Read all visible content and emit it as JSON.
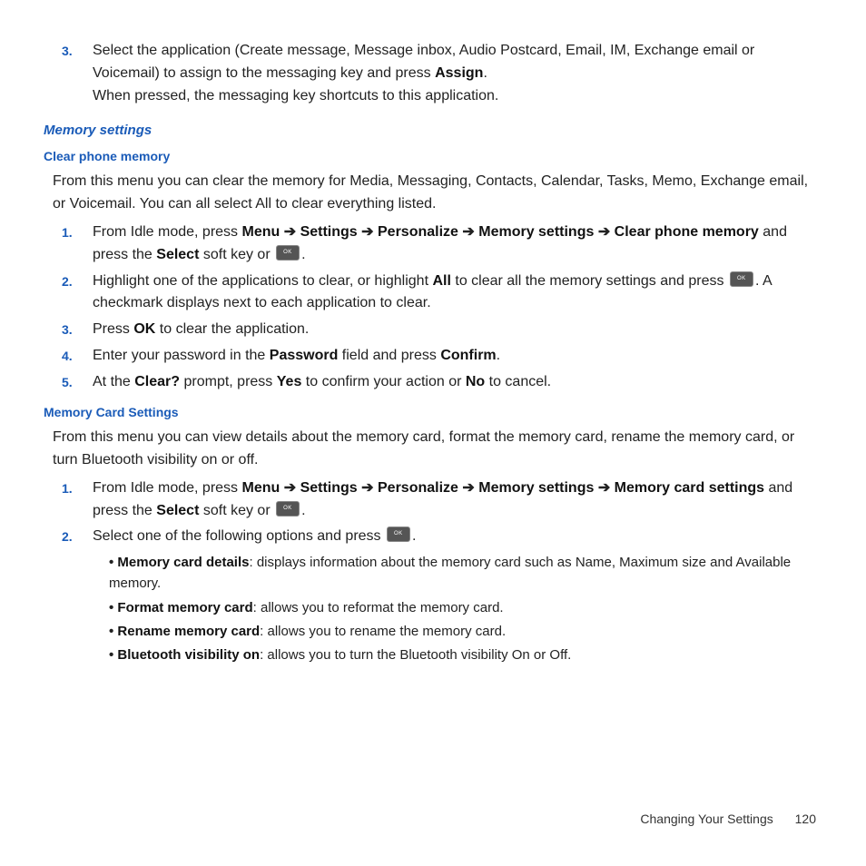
{
  "step3": {
    "num": "3.",
    "line1a": "Select the application (Create message, Message inbox, Audio Postcard, Email, IM, Exchange email or Voicemail) to assign to the messaging key and press ",
    "assign": "Assign",
    "line1b": ".",
    "line2": "When pressed, the messaging key shortcuts to this application."
  },
  "heading_memory_settings": "Memory settings",
  "heading_clear_phone": "Clear phone memory",
  "clear_intro": "From this menu you can clear the memory for Media, Messaging, Contacts, Calendar, Tasks, Memo, Exchange email, or Voicemail. You can all select All to clear everything listed.",
  "clear": {
    "s1": {
      "num": "1.",
      "a": "From Idle mode, press ",
      "menu": "Menu",
      "arr": " ➔ ",
      "settings": "Settings",
      "personalize": "Personalize",
      "memset": "Memory settings",
      "target": "Clear phone memory",
      "b": " and press the ",
      "select": "Select",
      "c": " soft key or ",
      "d": "."
    },
    "s2": {
      "num": "2.",
      "a": "Highlight one of the applications to clear, or highlight ",
      "all": "All",
      "b": " to clear all the memory settings and press ",
      "c": ". A checkmark displays next to each application to clear."
    },
    "s3": {
      "num": "3.",
      "a": "Press ",
      "ok": "OK",
      "b": " to clear the application."
    },
    "s4": {
      "num": "4.",
      "a": "Enter your password in the ",
      "pw": "Password",
      "b": " field and press ",
      "confirm": "Confirm",
      "c": "."
    },
    "s5": {
      "num": "5.",
      "a": "At the ",
      "clearq": "Clear?",
      "b": " prompt, press ",
      "yes": "Yes",
      "c": " to confirm your action or ",
      "no": "No",
      "d": " to cancel."
    }
  },
  "heading_card": "Memory Card Settings",
  "card_intro": "From this menu you can view details about the memory card, format the memory card, rename the memory card, or turn Bluetooth visibility on or off.",
  "card": {
    "s1": {
      "num": "1.",
      "a": "From Idle mode, press ",
      "menu": "Menu",
      "arr": " ➔ ",
      "settings": "Settings",
      "personalize": "Personalize",
      "memset": "Memory settings",
      "target": "Memory card settings",
      "b": " and press the ",
      "select": "Select",
      "c": " soft key or ",
      "d": "."
    },
    "s2": {
      "num": "2.",
      "a": "Select one of the following options and press ",
      "b": "."
    }
  },
  "bullets": {
    "b1t": "Memory card details",
    "b1d": ": displays information about the memory card such as Name, Maximum size and Available memory.",
    "b2t": "Format memory card",
    "b2d": ": allows you to reformat the memory card.",
    "b3t": "Rename memory card",
    "b3d": ": allows you to rename the memory card.",
    "b4t": "Bluetooth visibility on",
    "b4d": ": allows you to turn the Bluetooth visibility On or Off."
  },
  "footer": {
    "section": "Changing Your Settings",
    "page": "120"
  }
}
